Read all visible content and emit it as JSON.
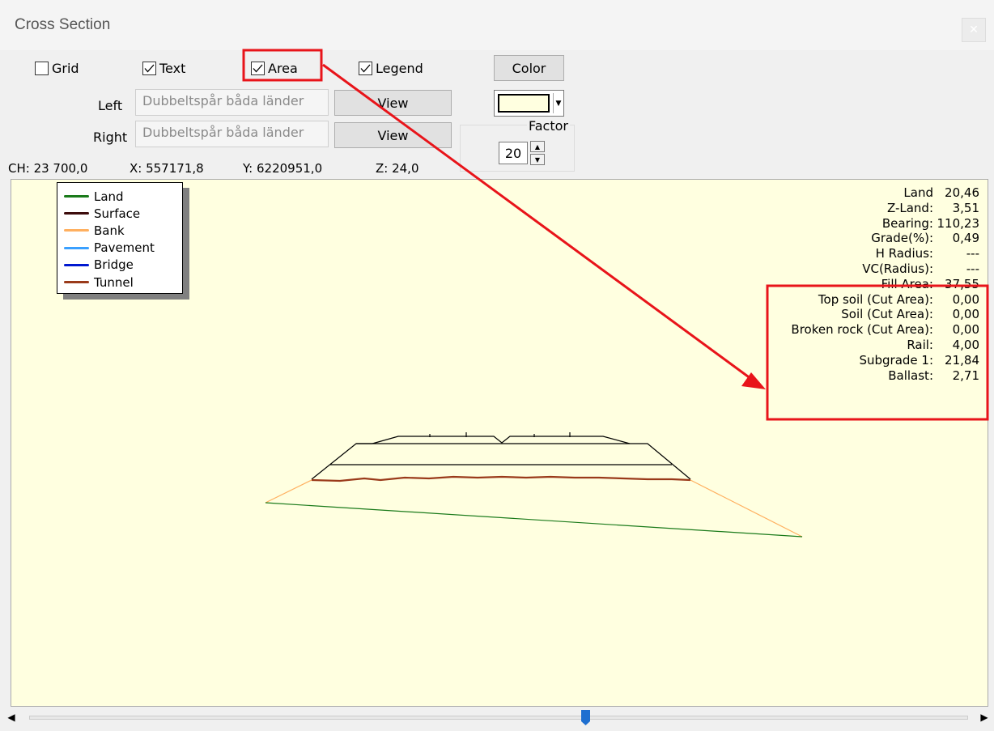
{
  "window": {
    "title": "Cross Section"
  },
  "options": {
    "grid": {
      "label": "Grid",
      "checked": false
    },
    "text": {
      "label": "Text",
      "checked": true
    },
    "area": {
      "label": "Area",
      "checked": true
    },
    "legend": {
      "label": "Legend",
      "checked": true
    },
    "color_button": "Color",
    "background_color": "#ffffe0"
  },
  "left": {
    "label": "Left",
    "value": "Dubbeltspår båda länder",
    "view_button": "View"
  },
  "right": {
    "label": "Right",
    "value": "Dubbeltspår båda länder",
    "view_button": "View"
  },
  "factor": {
    "label": "Factor",
    "value": "20"
  },
  "coords": {
    "ch": "CH: 23 700,0",
    "x": "X: 557171,8",
    "y": "Y: 6220951,0",
    "z": "Z: 24,0"
  },
  "legend_items": [
    {
      "label": "Land",
      "color": "#1a7a1a"
    },
    {
      "label": "Surface",
      "color": "#3d0c0c"
    },
    {
      "label": "Bank",
      "color": "#ffb060"
    },
    {
      "label": "Pavement",
      "color": "#3aa0ff"
    },
    {
      "label": "Bridge",
      "color": "#0018d0"
    },
    {
      "label": "Tunnel",
      "color": "#9a3a1a"
    }
  ],
  "info": [
    {
      "label": "Land",
      "value": "20,46"
    },
    {
      "label": "Z-Land:",
      "value": "3,51"
    },
    {
      "label": "Bearing:",
      "value": "110,23"
    },
    {
      "label": "Grade(%):",
      "value": "0,49"
    },
    {
      "label": "H Radius:",
      "value": "---"
    },
    {
      "label": "VC(Radius):",
      "value": "---"
    },
    {
      "label": "Fill Area:",
      "value": "37,55"
    },
    {
      "label": "Top soil (Cut Area):",
      "value": "0,00"
    },
    {
      "label": "Soil (Cut Area):",
      "value": "0,00"
    },
    {
      "label": "Broken rock (Cut Area):",
      "value": "0,00"
    },
    {
      "label": "Rail:",
      "value": "4,00"
    },
    {
      "label": "Subgrade 1:",
      "value": "21,84"
    },
    {
      "label": "Ballast:",
      "value": "2,71"
    }
  ],
  "annotation_color": "#e8141a",
  "scrollbar_position": 0.59
}
